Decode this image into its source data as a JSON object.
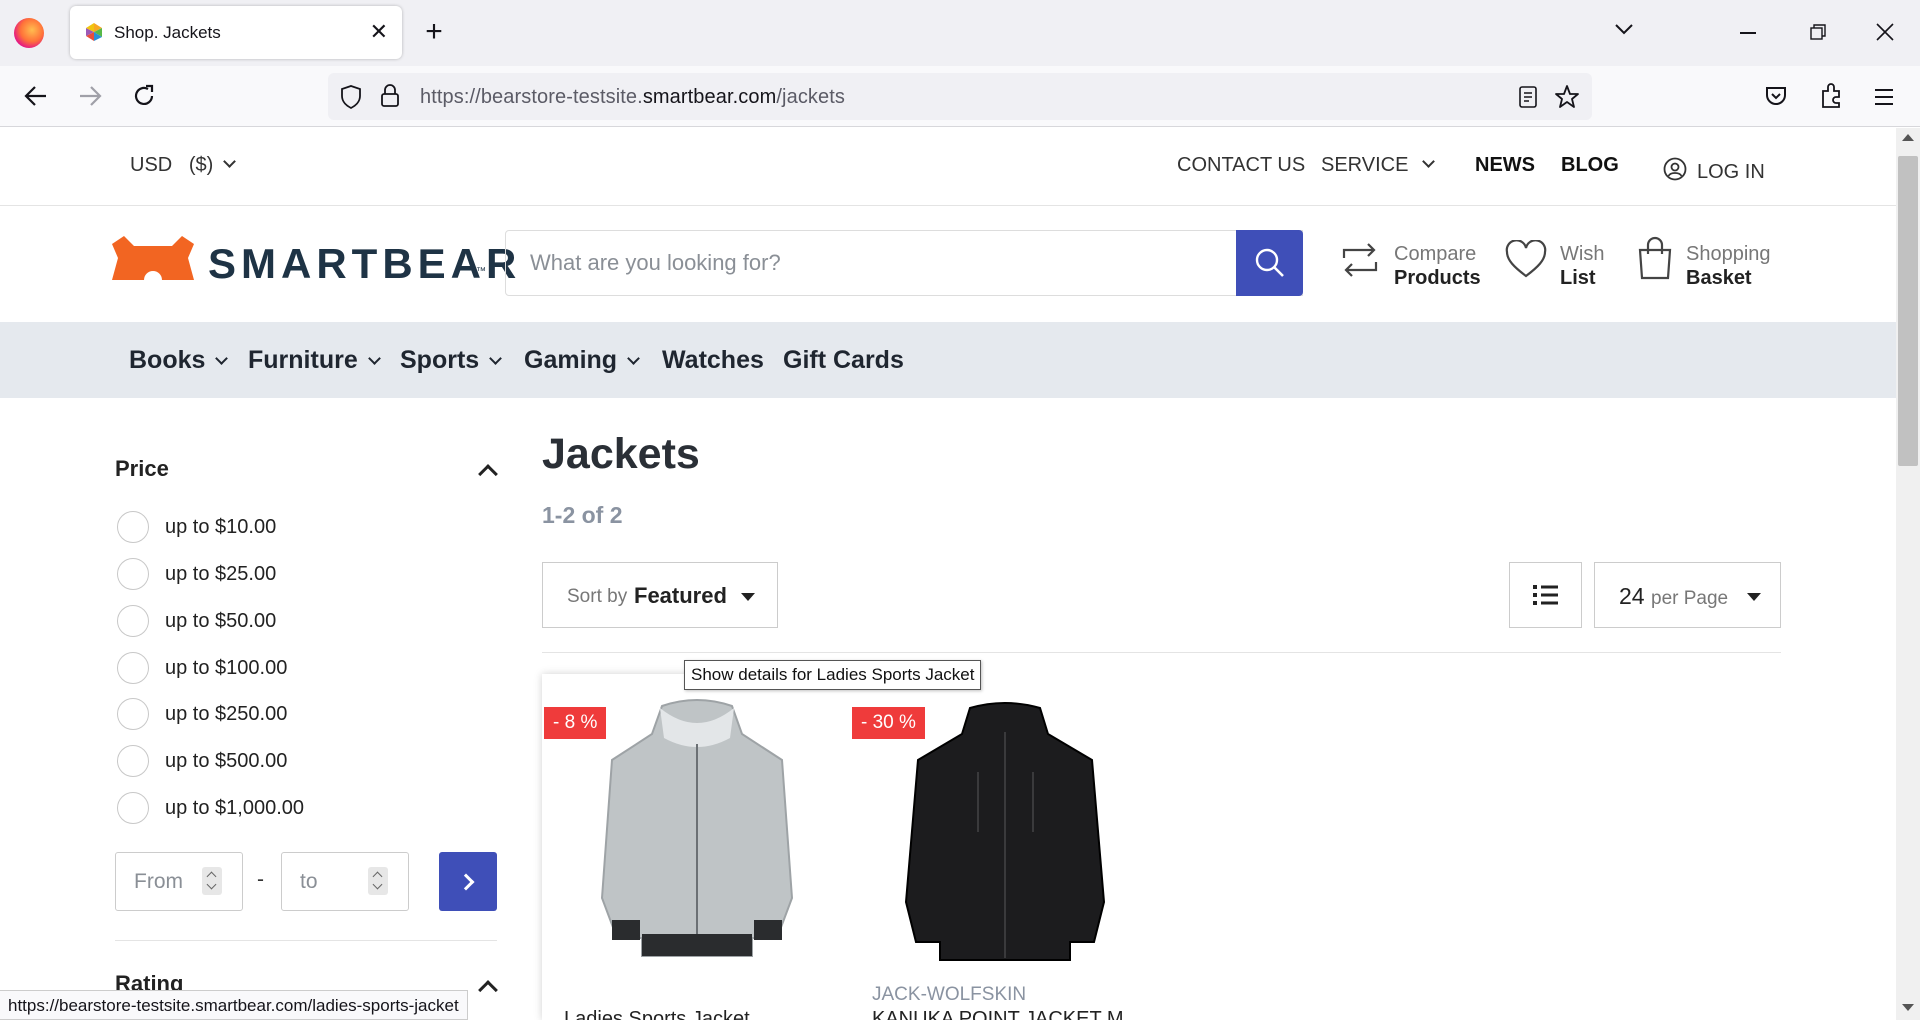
{
  "browser": {
    "tab_title": "Shop. Jackets",
    "url_prefix": "https://bearstore-testsite.",
    "url_domain": "smartbear.com",
    "url_path": "/jackets",
    "status_url": "https://bearstore-testsite.smartbear.com/ladies-sports-jacket",
    "new_tab_symbol": "+",
    "close_symbol": "✕"
  },
  "topbar": {
    "currency": "USD   ($)",
    "contact": "CONTACT US",
    "service": "SERVICE",
    "news": "NEWS",
    "blog": "BLOG",
    "login": "LOG IN"
  },
  "header": {
    "logo_text": "SMARTBEAR",
    "logo_tm": "™",
    "search_placeholder": "What are you looking for?",
    "compare_l1": "Compare",
    "compare_l2": "Products",
    "wish_l1": "Wish",
    "wish_l2": "List",
    "basket_l1": "Shopping",
    "basket_l2": "Basket"
  },
  "categories": [
    "Books",
    "Furniture",
    "Sports",
    "Gaming",
    "Watches",
    "Gift Cards"
  ],
  "sidebar": {
    "price_heading": "Price",
    "price_options": [
      "up to $10.00",
      "up to $25.00",
      "up to $50.00",
      "up to $100.00",
      "up to $250.00",
      "up to $500.00",
      "up to $1,000.00"
    ],
    "from_placeholder": "From",
    "to_placeholder": "to",
    "dash": "-",
    "rating_heading": "Rating"
  },
  "main": {
    "title": "Jackets",
    "count": "1-2 of 2",
    "sort_label": "Sort by",
    "sort_value": "Featured",
    "per_page_num": "24",
    "per_page_label": "per Page"
  },
  "products": [
    {
      "badge": "- 8 %",
      "brand": "",
      "name": "Ladies Sports Jacket",
      "color": "#bfc4c6"
    },
    {
      "badge": "- 30 %",
      "brand": "JACK-WOLFSKIN",
      "name": "KANUKA POINT JACKET M",
      "color": "#1c1c1e"
    }
  ],
  "tooltip": "Show details for Ladies Sports Jacket",
  "colors": {
    "accent": "#3f4fb8",
    "logo_orange": "#f26522",
    "sale_red": "#ef3b3b"
  }
}
